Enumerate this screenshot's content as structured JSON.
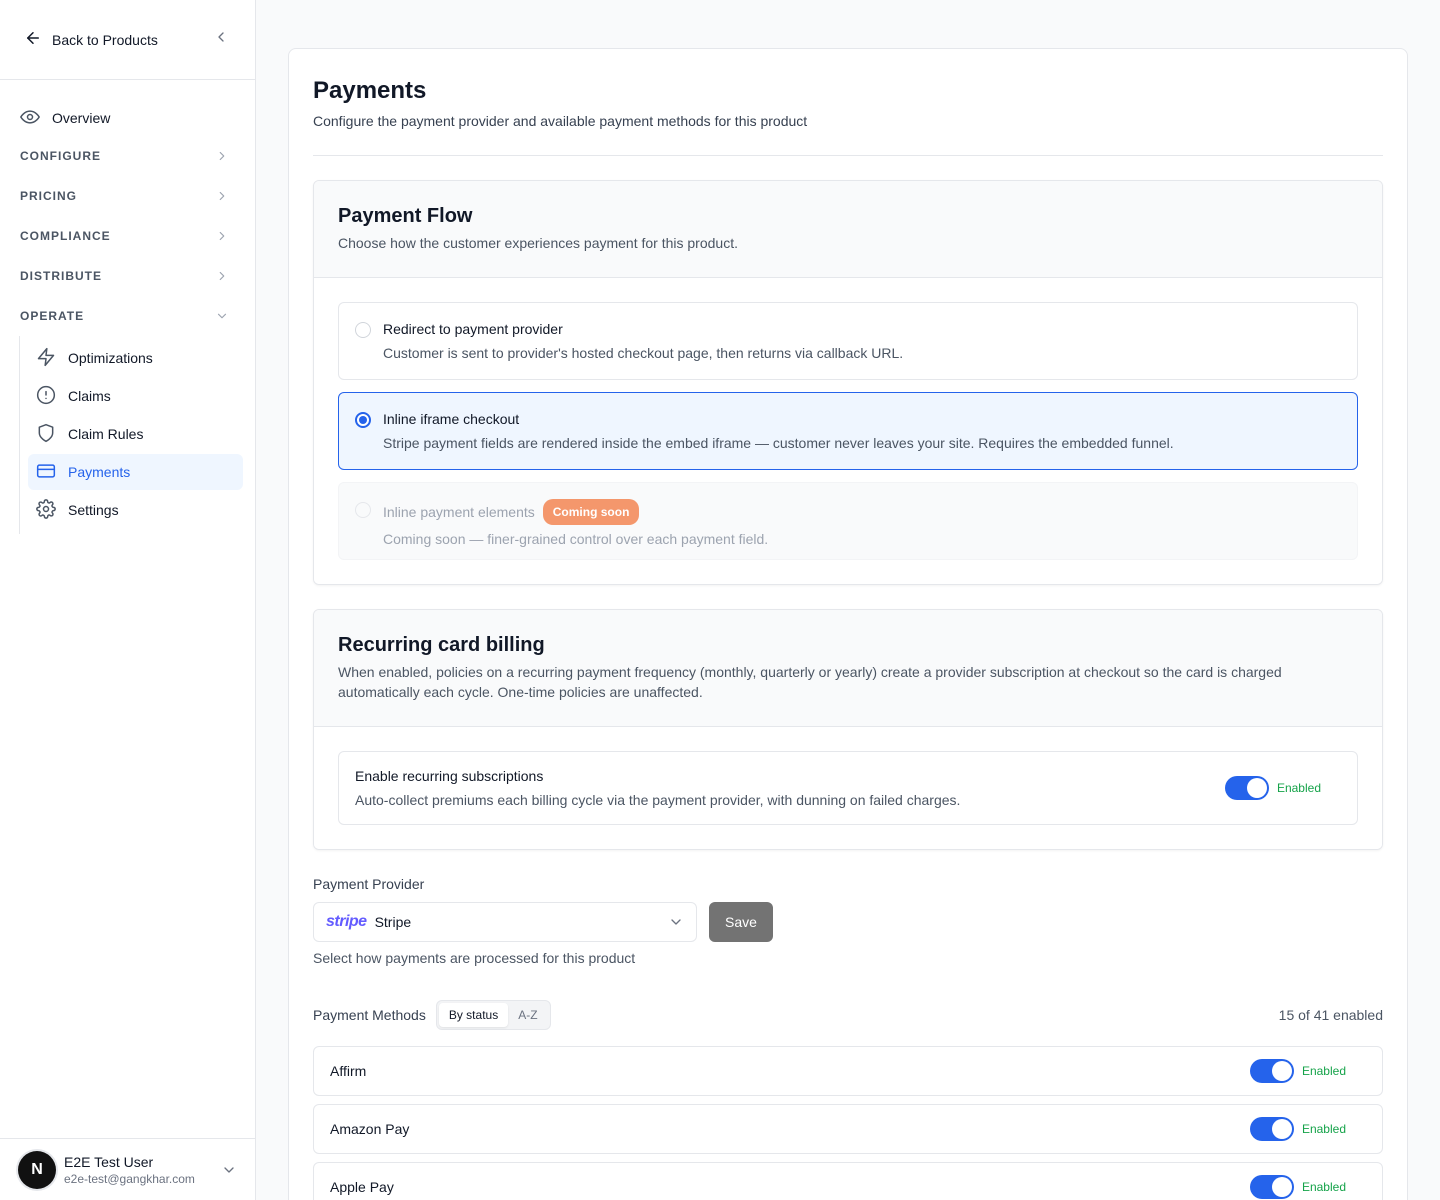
{
  "sidebar": {
    "back_label": "Back to Products",
    "overview_label": "Overview",
    "sections": [
      {
        "label": "CONFIGURE"
      },
      {
        "label": "PRICING"
      },
      {
        "label": "COMPLIANCE"
      },
      {
        "label": "DISTRIBUTE"
      },
      {
        "label": "OPERATE"
      }
    ],
    "operate_items": [
      {
        "label": "Optimizations",
        "icon": "lightning-icon"
      },
      {
        "label": "Claims",
        "icon": "alert-circle-icon"
      },
      {
        "label": "Claim Rules",
        "icon": "shield-icon"
      },
      {
        "label": "Payments",
        "icon": "credit-card-icon",
        "active": true
      },
      {
        "label": "Settings",
        "icon": "gear-icon"
      }
    ],
    "user": {
      "initial": "N",
      "name": "E2E Test User",
      "email": "e2e-test@gangkhar.com"
    }
  },
  "page": {
    "title": "Payments",
    "subtitle": "Configure the payment provider and available payment methods for this product"
  },
  "payment_flow": {
    "title": "Payment Flow",
    "description": "Choose how the customer experiences payment for this product.",
    "options": [
      {
        "title": "Redirect to payment provider",
        "description": "Customer is sent to provider's hosted checkout page, then returns via callback URL."
      },
      {
        "title": "Inline iframe checkout",
        "description": "Stripe payment fields are rendered inside the embed iframe — customer never leaves your site. Requires the embedded funnel."
      },
      {
        "title": "Inline payment elements",
        "badge": "Coming soon",
        "description": "Coming soon — finer-grained control over each payment field."
      }
    ],
    "selected_index": 1
  },
  "recurring": {
    "title": "Recurring card billing",
    "description": "When enabled, policies on a recurring payment frequency (monthly, quarterly or yearly) create a provider subscription at checkout so the card is charged automatically each cycle. One-time policies are unaffected.",
    "toggle_title": "Enable recurring subscriptions",
    "toggle_description": "Auto-collect premiums each billing cycle via the payment provider, with dunning on failed charges.",
    "status": "Enabled"
  },
  "provider": {
    "label": "Payment Provider",
    "logo_text": "stripe",
    "value": "Stripe",
    "save_label": "Save",
    "helper": "Select how payments are processed for this product"
  },
  "methods": {
    "label": "Payment Methods",
    "sort_options": [
      "By status",
      "A-Z"
    ],
    "count": "15 of 41 enabled",
    "items": [
      {
        "name": "Affirm",
        "status": "Enabled"
      },
      {
        "name": "Amazon Pay",
        "status": "Enabled"
      },
      {
        "name": "Apple Pay",
        "status": "Enabled"
      }
    ]
  },
  "colors": {
    "accent": "#2563eb",
    "enabled": "#16a34a",
    "badge": "#f4976c",
    "stripe": "#635bff"
  }
}
